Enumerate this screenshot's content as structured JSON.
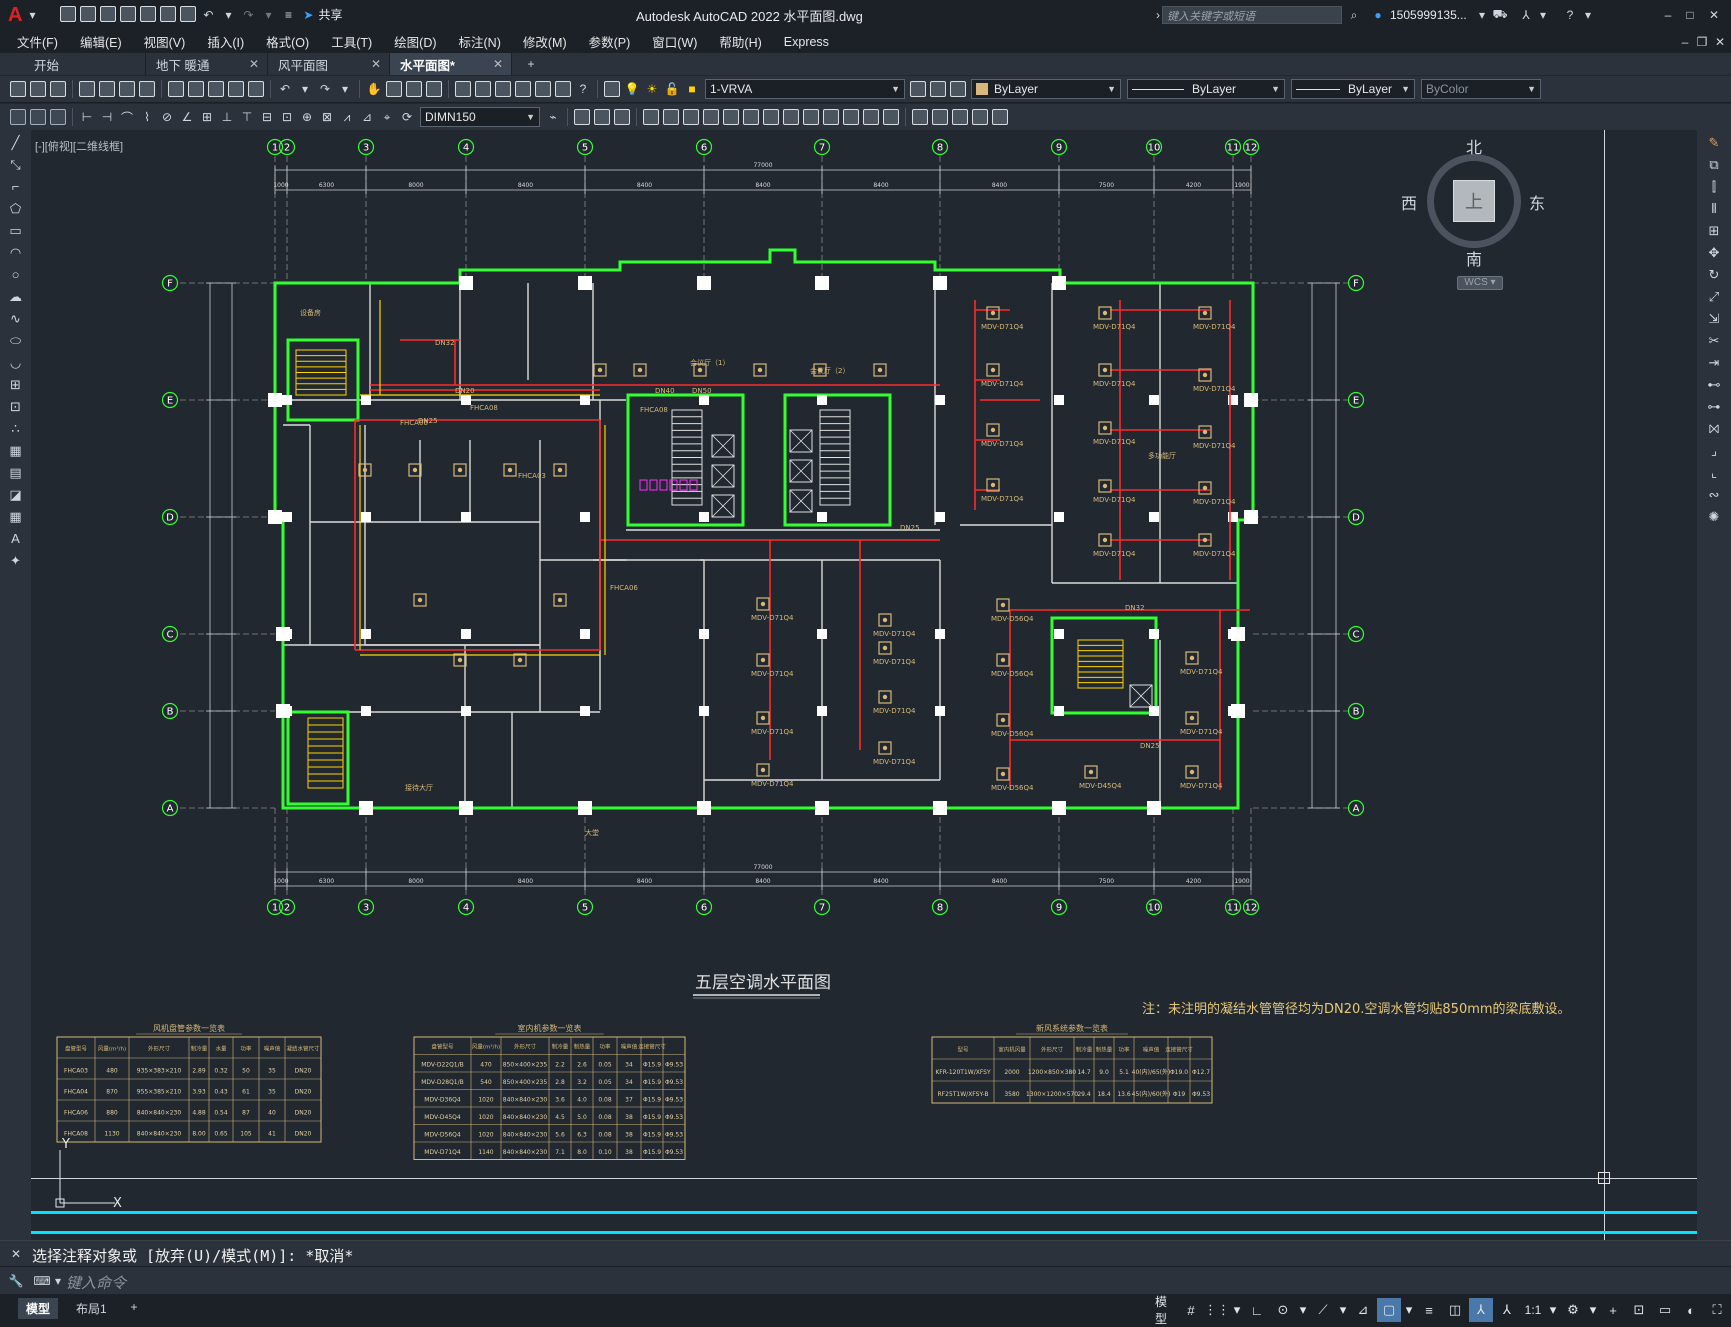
{
  "app": {
    "title": "Autodesk AutoCAD 2022    水平面图.dwg",
    "logo": "A",
    "share": "共享"
  },
  "search": {
    "placeholder": "键入关键字或短语"
  },
  "user": {
    "name": "1505999135..."
  },
  "menu": [
    "文件(F)",
    "编辑(E)",
    "视图(V)",
    "插入(I)",
    "格式(O)",
    "工具(T)",
    "绘图(D)",
    "标注(N)",
    "修改(M)",
    "参数(P)",
    "窗口(W)",
    "帮助(H)",
    "Express"
  ],
  "tabs": [
    {
      "label": "开始",
      "close": ""
    },
    {
      "label": "地下 暖通",
      "close": "✕"
    },
    {
      "label": "风平面图",
      "close": "✕"
    },
    {
      "label": "水平面图*",
      "close": "✕"
    }
  ],
  "toolbar": {
    "layer": "1-VRVA",
    "color": "ByLayer",
    "linetype": "ByLayer",
    "lineweight": "ByLayer",
    "plotstyle": "ByColor",
    "dimstyle": "DIMN150"
  },
  "viewport": {
    "label": "[-][俯视][二维线框]"
  },
  "viewcube": {
    "north": "北",
    "south": "南",
    "east": "东",
    "west": "西",
    "top": "上",
    "wcs": "WCS"
  },
  "ucs": {
    "x": "X",
    "y": "Y"
  },
  "drawing": {
    "title": "五层空调水平面图",
    "note": "注：未注明的凝结水管管径均为DN20.空调水管均贴850mm的梁底敷设。",
    "overall_dim": "77000",
    "grid_cols": [
      "1",
      "2",
      "3",
      "4",
      "5",
      "6",
      "7",
      "8",
      "9",
      "10",
      "11",
      "12"
    ],
    "grid_rows": [
      "F",
      "E",
      "D",
      "C",
      "B",
      "A"
    ],
    "top_dims": [
      "1000",
      "6300",
      "8000",
      "8400",
      "8400",
      "8400",
      "8400",
      "8400",
      "7500",
      "4200",
      "1900"
    ],
    "rooms": [
      "设备房",
      "会议厅（1）",
      "会议厅（2）",
      "多功能厅",
      "接待大厅",
      "大堂"
    ],
    "tags": [
      "MDV-D71Q4",
      "MDV-D56Q4",
      "MDV-D45Q4",
      "FHCA06",
      "FHCA08",
      "FHCA03",
      "DN32",
      "DN25",
      "DN20",
      "DN40",
      "DN50"
    ],
    "table1_title": "风机盘管参数一览表",
    "table1_headers": [
      "盘管型号",
      "风量(m³/h)",
      "外形尺寸",
      "制冷量",
      "水量",
      "功率",
      "噪声值",
      "凝结水管尺寸"
    ],
    "table1_rows": [
      [
        "FHCA03",
        "480",
        "935×383×210",
        "2.89",
        "0.32",
        "50",
        "35",
        "DN20"
      ],
      [
        "FHCA04",
        "870",
        "955×385×210",
        "3.93",
        "0.43",
        "61",
        "35",
        "DN20"
      ],
      [
        "FHCA06",
        "880",
        "840×840×230",
        "4.88",
        "0.54",
        "87",
        "40",
        "DN20"
      ],
      [
        "FHCA08",
        "1130",
        "840×840×230",
        "8.00",
        "0.65",
        "105",
        "41",
        "DN20"
      ]
    ],
    "table2_title": "室内机参数一览表",
    "table2_headers": [
      "盘管型号",
      "风量(m³/h)",
      "外形尺寸",
      "制冷量",
      "制热量",
      "功率",
      "噪声值",
      "连接管尺寸"
    ],
    "table2_rows": [
      [
        "MDV-D22Q1/B",
        "470",
        "850×400×235",
        "2.2",
        "2.6",
        "0.05",
        "34",
        "Φ15.9",
        "Φ9.53"
      ],
      [
        "MDV-D28Q1/B",
        "540",
        "850×400×235",
        "2.8",
        "3.2",
        "0.05",
        "34",
        "Φ15.9",
        "Φ9.53"
      ],
      [
        "MDV-D36Q4",
        "1020",
        "840×840×230",
        "3.6",
        "4.0",
        "0.08",
        "37",
        "Φ15.9",
        "Φ9.53"
      ],
      [
        "MDV-D45Q4",
        "1020",
        "840×840×230",
        "4.5",
        "5.0",
        "0.08",
        "38",
        "Φ15.9",
        "Φ9.53"
      ],
      [
        "MDV-D56Q4",
        "1020",
        "840×840×230",
        "5.6",
        "6.3",
        "0.08",
        "38",
        "Φ15.9",
        "Φ9.53"
      ],
      [
        "MDV-D71Q4",
        "1140",
        "840×840×230",
        "7.1",
        "8.0",
        "0.10",
        "38",
        "Φ15.9",
        "Φ9.53"
      ]
    ],
    "table3_title": "新风系统参数一览表",
    "table3_headers": [
      "型号",
      "室内机风量",
      "外形尺寸",
      "制冷量",
      "制热量",
      "功率",
      "噪声值",
      "连接管尺寸"
    ],
    "table3_rows": [
      [
        "KFR-120T1W/XFSY",
        "2000",
        "1200×850×380",
        "14.7",
        "9.0",
        "5.1",
        "40(内)/65(外)",
        "Φ19.0",
        "Φ12.7"
      ],
      [
        "RF25T1W/XFSY-B",
        "3580",
        "1300×1200×570",
        "29.4",
        "18.4",
        "13.6",
        "45(内)/60(外)",
        "Φ19",
        "Φ9.53"
      ]
    ]
  },
  "command": {
    "history": "选择注释对象或 [放弃(U)/模式(M)]: *取消*",
    "placeholder": "键入命令"
  },
  "layouts": [
    "模型",
    "布局1"
  ],
  "status": {
    "model": "模型",
    "scale": "1:1"
  },
  "colors": {
    "wall": "#32ff32",
    "pipe": "#ff2a2a",
    "tag": "#d8b878",
    "grid": "#c8c8c8",
    "bg": "#212830",
    "cyan": "#00e5ff",
    "yellow": "#ffd400",
    "magenta": "#ff2bff"
  }
}
